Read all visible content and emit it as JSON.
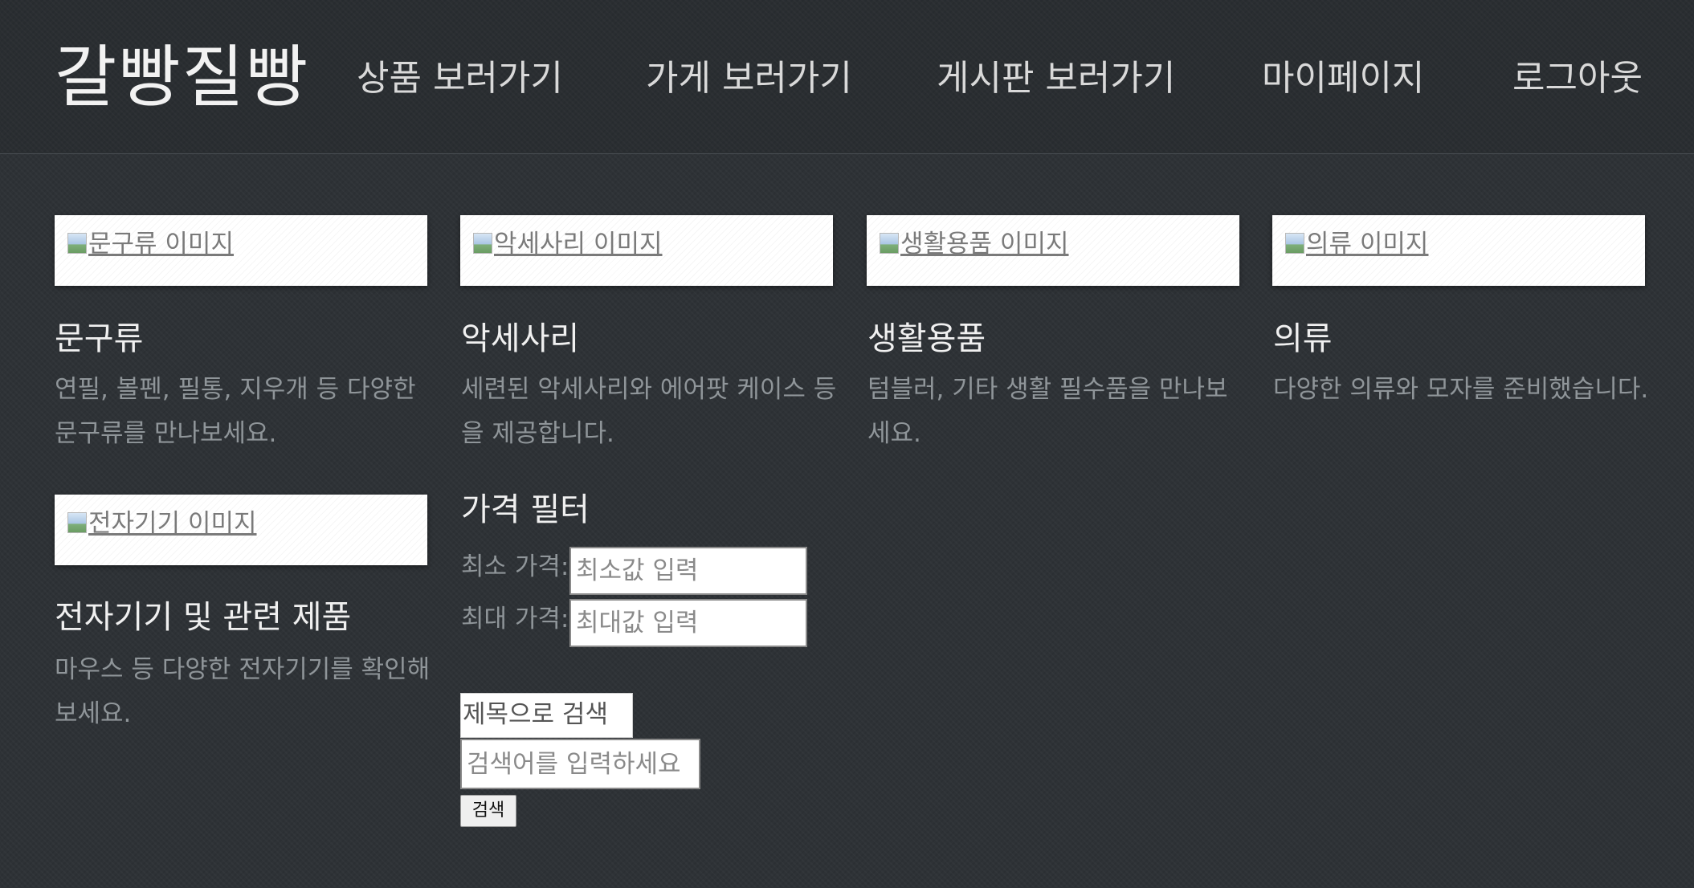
{
  "header": {
    "logo": "갈빵질빵",
    "nav": [
      {
        "label": "상품 보러가기"
      },
      {
        "label": "가게 보러가기"
      },
      {
        "label": "게시판 보러가기"
      },
      {
        "label": "마이페이지"
      },
      {
        "label": "로그아웃"
      }
    ]
  },
  "categories": [
    {
      "image_alt": "문구류 이미지",
      "title": "문구류",
      "description": "연필, 볼펜, 필통, 지우개 등 다양한 문구류를 만나보세요."
    },
    {
      "image_alt": "악세사리 이미지",
      "title": "악세사리",
      "description": "세련된 악세사리와 에어팟 케이스 등을 제공합니다."
    },
    {
      "image_alt": "생활용품 이미지",
      "title": "생활용품",
      "description": "텀블러, 기타 생활 필수품을 만나보세요."
    },
    {
      "image_alt": "의류 이미지",
      "title": "의류",
      "description": "다양한 의류와 모자를 준비했습니다."
    },
    {
      "image_alt": "전자기기 이미지",
      "title": "전자기기 및 관련 제품",
      "description": "마우스 등 다양한 전자기기를 확인해보세요."
    }
  ],
  "price_filter": {
    "title": "가격 필터",
    "min_label": "최소 가격:",
    "min_placeholder": "최소값 입력",
    "max_label": "최대 가격:",
    "max_placeholder": "최대값 입력"
  },
  "search": {
    "type_selected": "제목으로 검색",
    "placeholder": "검색어를 입력하세요",
    "button_label": "검색"
  },
  "colors": {
    "background": "#2e3236",
    "text_primary": "#f0f0f0",
    "text_muted": "#8f9599"
  }
}
